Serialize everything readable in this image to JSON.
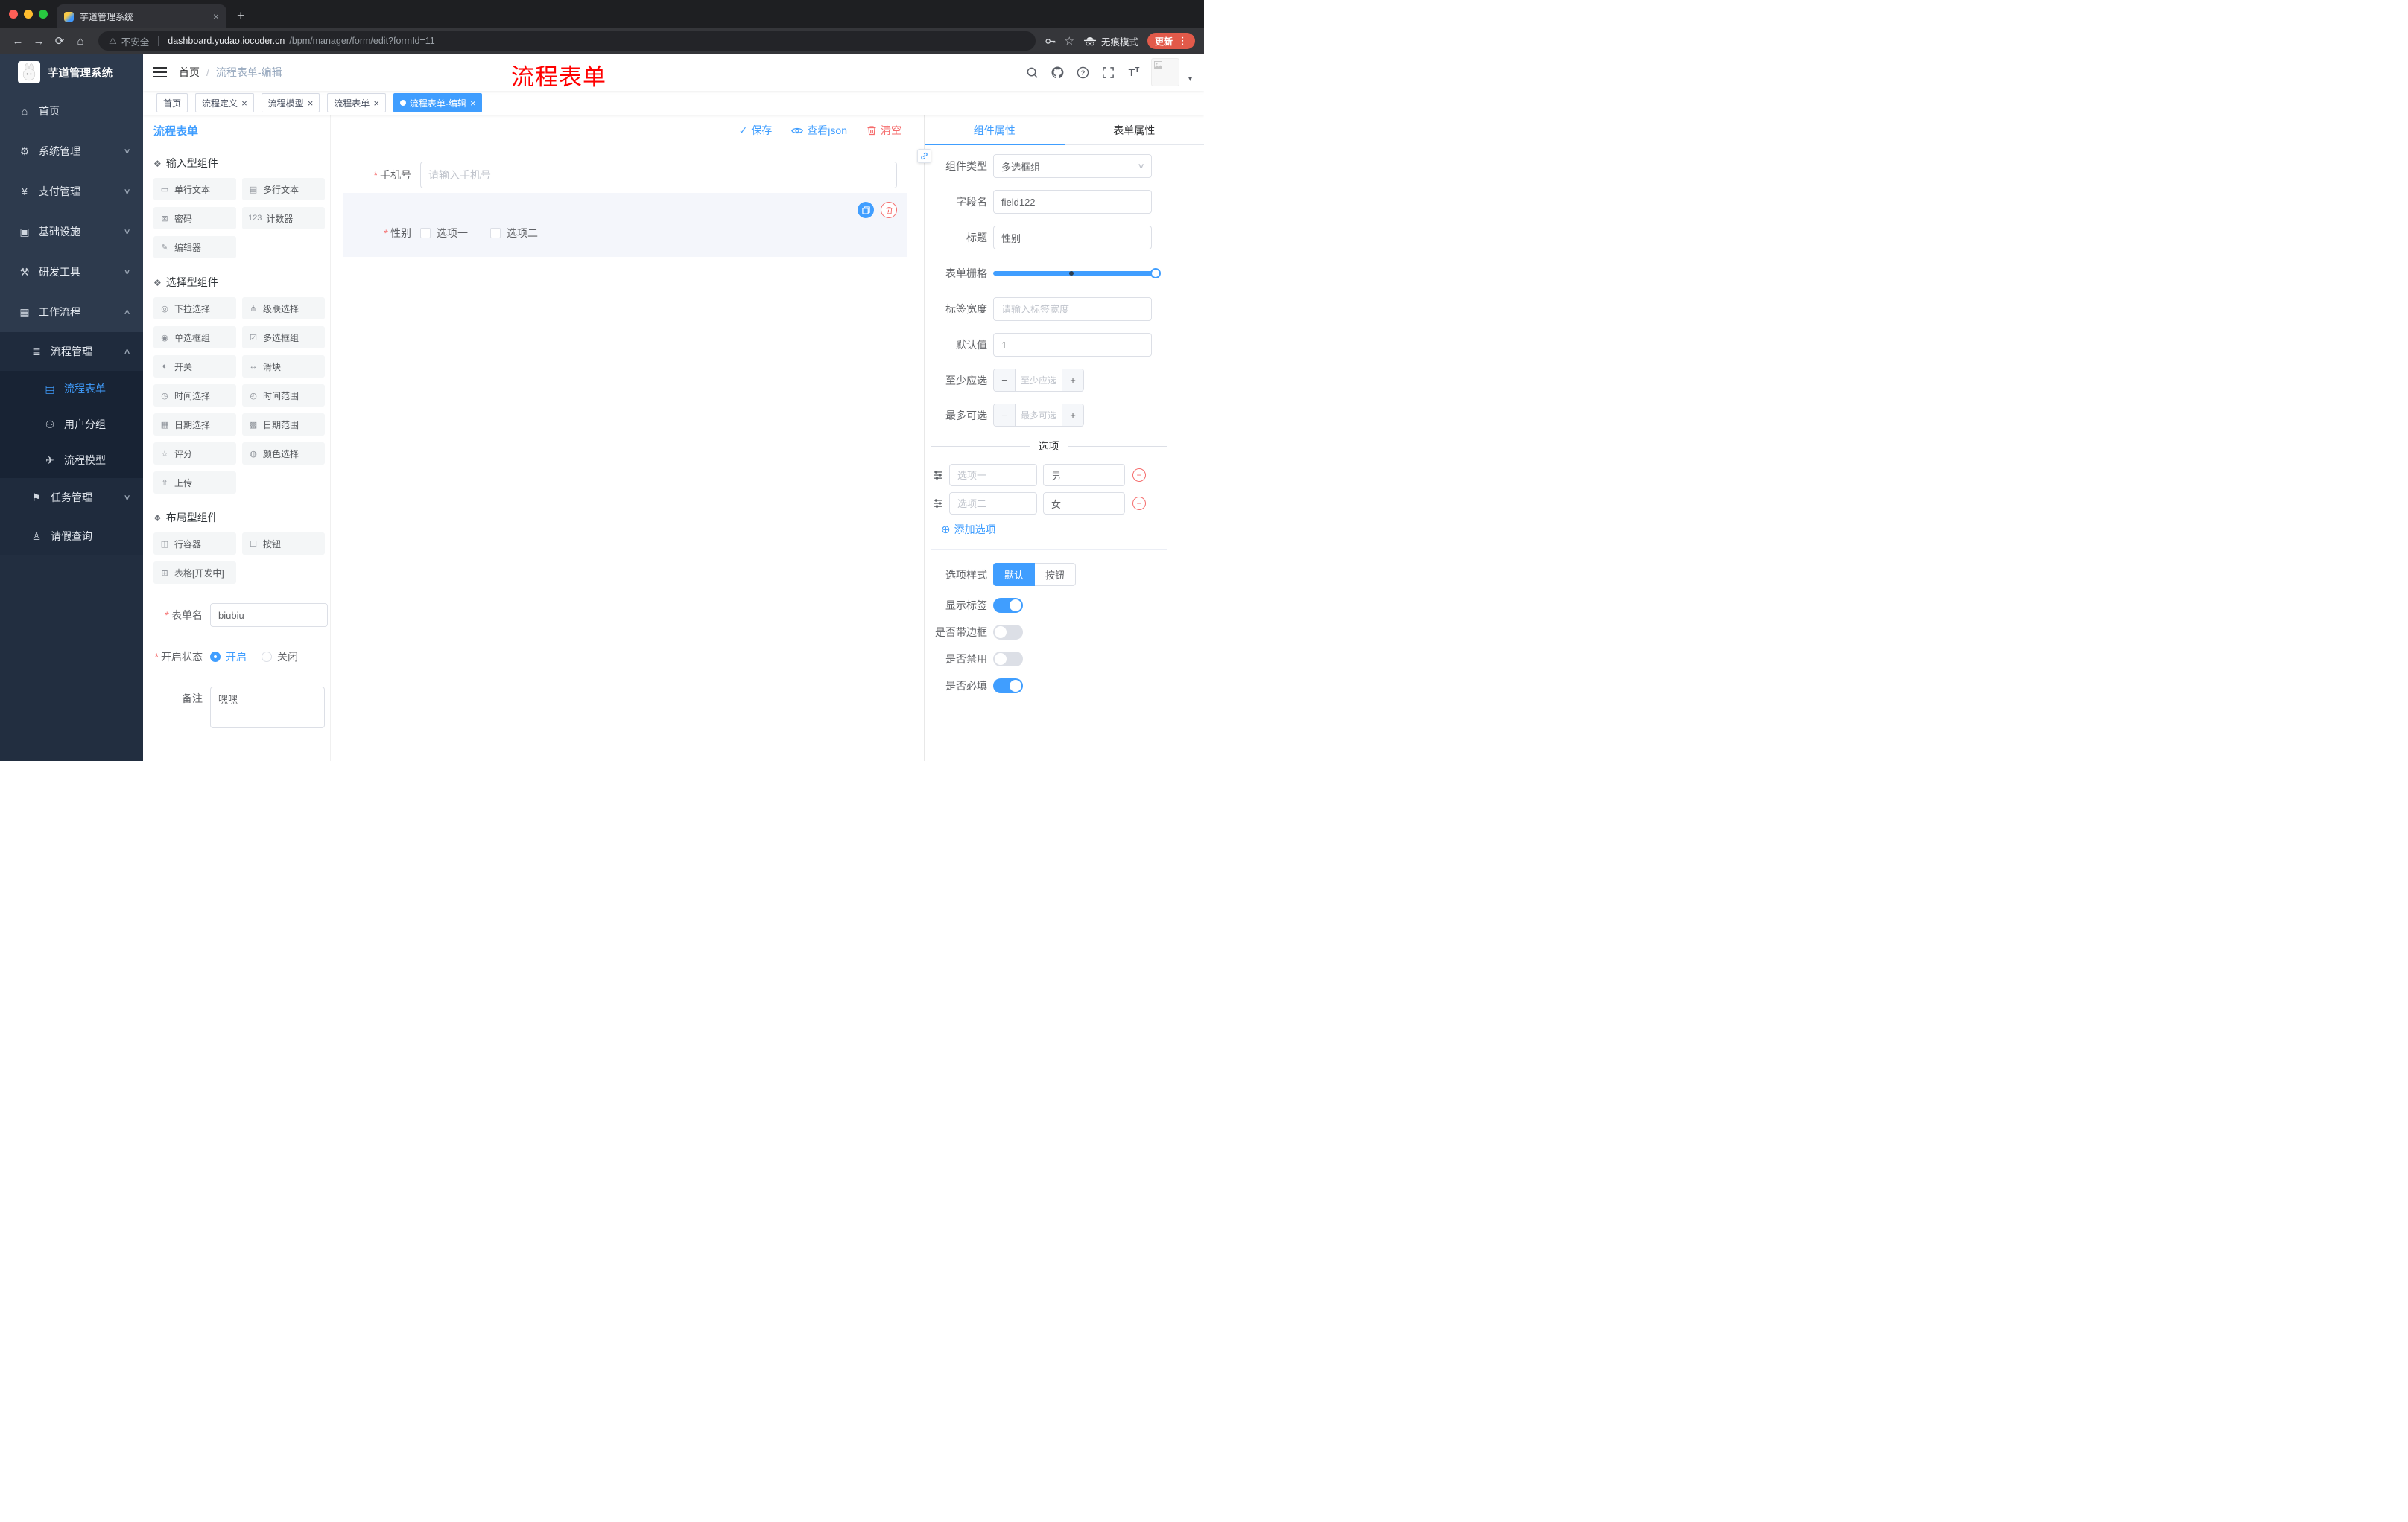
{
  "theme": {
    "accent": "#409eff",
    "danger": "#f56c6c",
    "annotation_red": "#ff0000",
    "sidebar_bg": "#2d3a4d"
  },
  "browser": {
    "tab_title": "芋道管理系统",
    "security_label": "不安全",
    "url_host": "dashboard.yudao.iocoder.cn",
    "url_path": "/bpm/manager/form/edit?formId=11",
    "incognito_label": "无痕模式",
    "update_label": "更新"
  },
  "annotation": {
    "text": "流程表单"
  },
  "sidebar": {
    "logo_title": "芋道管理系统",
    "menu": [
      {
        "label": "首页",
        "glyph": "⌂",
        "icon": "home-icon",
        "cls": "lvl1"
      },
      {
        "label": "系统管理",
        "glyph": "⚙",
        "icon": "gear-icon",
        "cls": "lvl1",
        "chevron_cls": "down"
      },
      {
        "label": "支付管理",
        "glyph": "¥",
        "icon": "payment-icon",
        "cls": "lvl1",
        "chevron_cls": "down"
      },
      {
        "label": "基础设施",
        "glyph": "▣",
        "icon": "infrastructure-icon",
        "cls": "lvl1",
        "chevron_cls": "down"
      },
      {
        "label": "研发工具",
        "glyph": "⚒",
        "icon": "devtools-icon",
        "cls": "lvl1",
        "chevron_cls": "down"
      },
      {
        "label": "工作流程",
        "glyph": "▦",
        "icon": "workflow-icon",
        "cls": "lvl1",
        "chevron_cls": "up"
      },
      {
        "label": "流程管理",
        "glyph": "≣",
        "icon": "process-management-icon",
        "cls": "lvl2",
        "chevron_cls": "up"
      },
      {
        "label": "流程表单",
        "glyph": "▤",
        "icon": "process-form-icon",
        "cls": "lvl3 active"
      },
      {
        "label": "用户分组",
        "glyph": "⚇",
        "icon": "user-group-icon",
        "cls": "lvl3"
      },
      {
        "label": "流程模型",
        "glyph": "✈",
        "icon": "process-model-icon",
        "cls": "lvl3"
      },
      {
        "label": "任务管理",
        "glyph": "⚑",
        "icon": "task-management-icon",
        "cls": "lvl2",
        "chevron_cls": "down"
      },
      {
        "label": "请假查询",
        "glyph": "♙",
        "icon": "leave-query-icon",
        "cls": "lvl2"
      }
    ]
  },
  "header": {
    "breadcrumb_home": "首页",
    "breadcrumb_sep": "/",
    "breadcrumb_current": "流程表单-编辑"
  },
  "tags": [
    {
      "label": "首页"
    },
    {
      "label": "流程定义",
      "closable": true
    },
    {
      "label": "流程模型",
      "closable": true
    },
    {
      "label": "流程表单",
      "closable": true
    },
    {
      "label": "流程表单-编辑",
      "closable": true,
      "active": true,
      "cls": "active"
    }
  ],
  "palette": {
    "title": "流程表单",
    "sections": [
      {
        "title": "输入型组件",
        "items": [
          {
            "label": "单行文本",
            "glyph": "▭",
            "icon": "single-line-text-icon"
          },
          {
            "label": "多行文本",
            "glyph": "▤",
            "icon": "multi-line-text-icon"
          },
          {
            "label": "密码",
            "glyph": "⊠",
            "icon": "password-icon"
          },
          {
            "label": "计数器",
            "glyph": "123",
            "icon": "counter-icon"
          },
          {
            "label": "编辑器",
            "glyph": "✎",
            "icon": "editor-icon"
          }
        ]
      },
      {
        "title": "选择型组件",
        "items": [
          {
            "label": "下拉选择",
            "glyph": "◎",
            "icon": "select-icon"
          },
          {
            "label": "级联选择",
            "glyph": "⋔",
            "icon": "cascader-icon"
          },
          {
            "label": "单选框组",
            "glyph": "◉",
            "icon": "radio-group-icon"
          },
          {
            "label": "多选框组",
            "glyph": "☑",
            "icon": "checkbox-group-icon"
          },
          {
            "label": "开关",
            "glyph": "◐",
            "icon": "switch-icon"
          },
          {
            "label": "滑块",
            "glyph": "↔",
            "icon": "slider-icon"
          },
          {
            "label": "时间选择",
            "glyph": "◷",
            "icon": "time-picker-icon"
          },
          {
            "label": "时间范围",
            "glyph": "◴",
            "icon": "time-range-icon"
          },
          {
            "label": "日期选择",
            "glyph": "▦",
            "icon": "date-picker-icon"
          },
          {
            "label": "日期范围",
            "glyph": "▩",
            "icon": "date-range-icon"
          },
          {
            "label": "评分",
            "glyph": "☆",
            "icon": "rate-icon"
          },
          {
            "label": "颜色选择",
            "glyph": "◍",
            "icon": "color-picker-icon"
          },
          {
            "label": "上传",
            "glyph": "⇧",
            "icon": "upload-icon"
          }
        ]
      },
      {
        "title": "布局型组件",
        "items": [
          {
            "label": "行容器",
            "glyph": "◫",
            "icon": "row-container-icon"
          },
          {
            "label": "按钮",
            "glyph": "☐",
            "icon": "button-icon"
          },
          {
            "label": "表格[开发中]",
            "glyph": "⊞",
            "icon": "table-icon"
          }
        ]
      }
    ],
    "form": {
      "name_label": "表单名",
      "name_value": "biubiu",
      "status_label": "开启状态",
      "status_on": "开启",
      "status_off": "关闭",
      "remark_label": "备注",
      "remark_value": "嘿嘿"
    }
  },
  "canvas": {
    "toolbar": {
      "save": "保存",
      "view_json": "查看json",
      "clear": "清空"
    },
    "phone": {
      "label": "手机号",
      "placeholder": "请输入手机号"
    },
    "gender": {
      "label": "性别",
      "options": [
        {
          "label": "选项一"
        },
        {
          "label": "选项二"
        }
      ]
    }
  },
  "props": {
    "tab_component": "组件属性",
    "tab_form": "表单属性",
    "rows": {
      "component_type_label": "组件类型",
      "component_type_value": "多选框组",
      "field_name_label": "字段名",
      "field_name_value": "field122",
      "title_label": "标题",
      "title_value": "性别",
      "grid_label": "表单栅格",
      "label_width_label": "标签宽度",
      "label_width_placeholder": "请输入标签宽度",
      "default_label": "默认值",
      "default_value": "1",
      "min_label": "至少应选",
      "min_placeholder": "至少应选",
      "max_label": "最多可选",
      "max_placeholder": "最多可选"
    },
    "options_divider": "选项",
    "options": [
      {
        "label_placeholder": "选项一",
        "value": "男"
      },
      {
        "label_placeholder": "选项二",
        "value": "女"
      }
    ],
    "add_option": "添加选项",
    "option_style_label": "选项样式",
    "option_style_default": "默认",
    "option_style_button": "按钮",
    "toggles": [
      {
        "label": "显示标签",
        "cls": "on"
      },
      {
        "label": "是否带边框",
        "cls": "off"
      },
      {
        "label": "是否禁用",
        "cls": "off"
      },
      {
        "label": "是否必填",
        "cls": "on"
      }
    ]
  }
}
